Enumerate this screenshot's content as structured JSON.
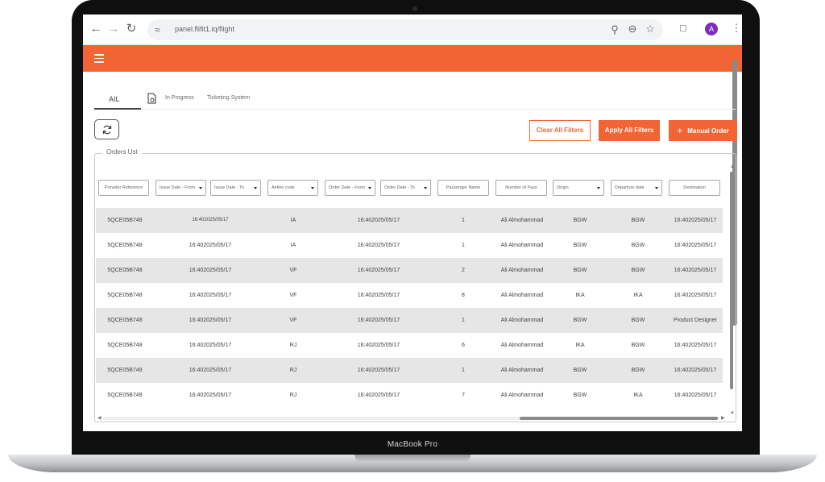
{
  "device": {
    "label": "MacBook Pro"
  },
  "browser": {
    "url": "panel.flifit1.iq/flight",
    "avatar_initial": "A",
    "icons": [
      "back-icon",
      "forward-icon",
      "reload-icon",
      "site-settings-icon",
      "key-icon",
      "zoom-out-icon",
      "star-icon",
      "extensions-icon",
      "kebab-menu-icon"
    ]
  },
  "header": {
    "color": "#f26434",
    "menu_icon": "hamburger-icon"
  },
  "tabs": [
    {
      "label": "AIL"
    },
    {
      "label": "In Progress"
    },
    {
      "label": "Ticketing System"
    }
  ],
  "actions": {
    "clear_filters": "Clear All Filters",
    "apply_filters": "Apply All Filters",
    "manual_order": "Manual Order"
  },
  "orders": {
    "legend": "Orders Ust",
    "filters": [
      {
        "label": "Provider Reference",
        "dropdown": false
      },
      {
        "label": "Issue Date - From",
        "dropdown": true
      },
      {
        "label": "Issue Date - To",
        "dropdown": true
      },
      {
        "label": "Airline code",
        "dropdown": true
      },
      {
        "label": "Order Date - From",
        "dropdown": true
      },
      {
        "label": "Order Date - To",
        "dropdown": true
      },
      {
        "label": "Passenger Name",
        "dropdown": false
      },
      {
        "label": "Number of Pass",
        "dropdown": false
      },
      {
        "label": "Origin",
        "dropdown": true
      },
      {
        "label": "Departure date",
        "dropdown": true
      },
      {
        "label": "Destination",
        "dropdown": false
      }
    ],
    "rows": [
      [
        "5QCE05B748",
        "16:402025/05/17",
        "IA",
        "16:402025/05/17",
        "1",
        "Ali Almohammad",
        "BGW",
        "BGW",
        "16:402025/05/17"
      ],
      [
        "5QCE05B748",
        "16:402025/05/17",
        "IA",
        "16:402025/05/17",
        "1",
        "Ali Almohammad",
        "BGW",
        "BGW",
        "16:402025/05/17"
      ],
      [
        "5QCE05B748",
        "16:402025/05/17",
        "VF",
        "16:402025/05/17",
        "2",
        "Ali Almohammad",
        "BGW",
        "BGW",
        "16:402025/05/17"
      ],
      [
        "5QCE05B748",
        "16:402025/05/17",
        "VF",
        "16:402025/05/17",
        "8",
        "Ali Almohammad",
        "IKA",
        "IKA",
        "16:402025/05/17"
      ],
      [
        "5QCE05B748",
        "16:402025/05/17",
        "VF",
        "16:402025/05/17",
        "1",
        "Ali Almohammad",
        "BGW",
        "BGW",
        "Product Designer"
      ],
      [
        "5QCE05B748",
        "16:402025/05/17",
        "RJ",
        "16:402025/05/17",
        "6",
        "Ali Almohammad",
        "IKA",
        "BGW",
        "16:402025/05/17"
      ],
      [
        "5QCE05B748",
        "16:402025/05/17",
        "RJ",
        "16:402025/05/17",
        "1",
        "Ali Almohammad",
        "BGW",
        "BGW",
        "16:402025/05/17"
      ],
      [
        "5QCE05B748",
        "16:402025/05/17",
        "RJ",
        "16:402025/05/17",
        "7",
        "Ali Almohammad",
        "BGW",
        "IKA",
        "16:402025/05/17"
      ]
    ]
  }
}
